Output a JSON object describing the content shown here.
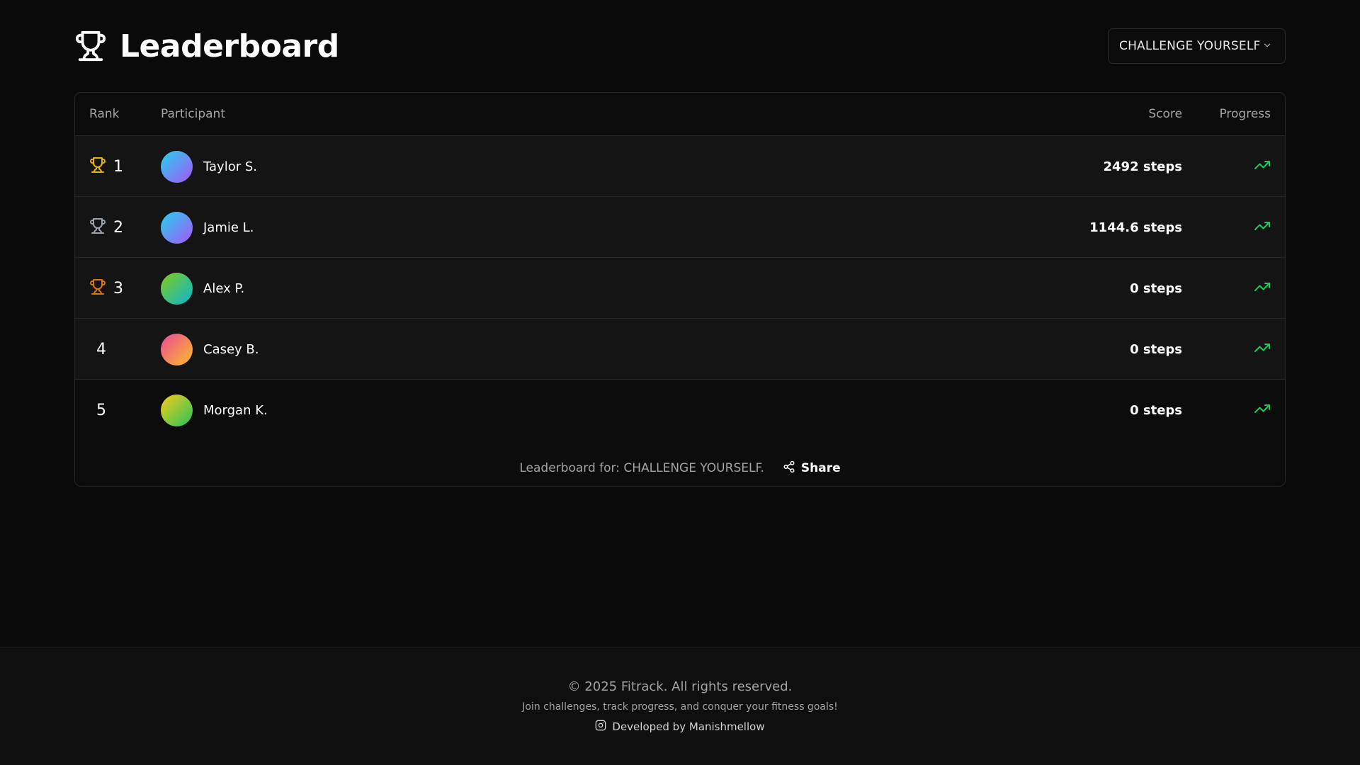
{
  "header": {
    "title": "Leaderboard",
    "challenge_select": "CHALLENGE YOURSELF"
  },
  "table": {
    "columns": {
      "rank": "Rank",
      "participant": "Participant",
      "score": "Score",
      "progress": "Progress"
    },
    "rows": [
      {
        "rank": "1",
        "name": "Taylor S.",
        "score": "2492 steps",
        "trophy": "gold-trophy-icon",
        "trophy_color": "#eab308",
        "avatar_gradient": [
          "#22d3ee",
          "#a855f7"
        ]
      },
      {
        "rank": "2",
        "name": "Jamie L.",
        "score": "1144.6 steps",
        "trophy": "silver-trophy-icon",
        "trophy_color": "#9ca3af",
        "avatar_gradient": [
          "#22d3ee",
          "#a855f7"
        ]
      },
      {
        "rank": "3",
        "name": "Alex P.",
        "score": "0 steps",
        "trophy": "bronze-trophy-icon",
        "trophy_color": "#d97706",
        "avatar_gradient": [
          "#84cc16",
          "#06b6d4"
        ]
      },
      {
        "rank": "4",
        "name": "Casey B.",
        "score": "0 steps",
        "trophy": "",
        "trophy_color": "",
        "avatar_gradient": [
          "#ec4899",
          "#fbbf24"
        ]
      },
      {
        "rank": "5",
        "name": "Morgan K.",
        "score": "0 steps",
        "trophy": "",
        "trophy_color": "",
        "avatar_gradient": [
          "#facc15",
          "#22c55e"
        ]
      }
    ],
    "progress_icon": "trending-up-icon",
    "progress_color": "#22c55e",
    "footer_caption": "Leaderboard for: CHALLENGE YOURSELF.",
    "share_label": "Share"
  },
  "footer": {
    "copyright": "© 2025 Fitrack. All rights reserved.",
    "tagline": "Join challenges, track progress, and conquer your fitness goals!",
    "developer": "Developed by Manishmellow"
  }
}
